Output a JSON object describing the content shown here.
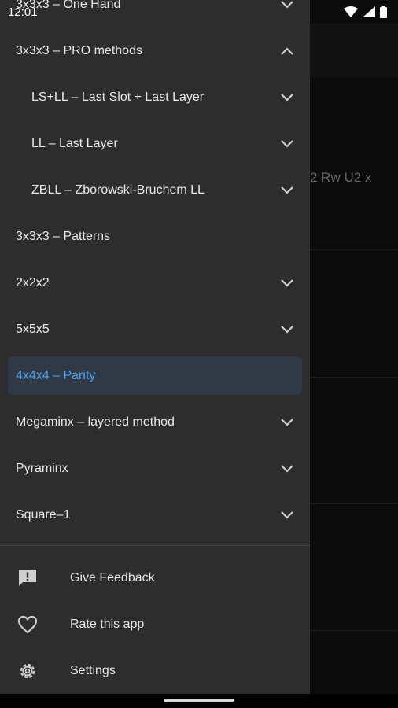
{
  "status_bar": {
    "time": "12:01"
  },
  "background": {
    "partial_text": "2 Rw U2 x"
  },
  "drawer": {
    "items": [
      {
        "label": "3x3x3 – One Hand",
        "level": "top",
        "chevron": "down",
        "selected": false
      },
      {
        "label": "3x3x3 – PRO methods",
        "level": "top",
        "chevron": "up",
        "selected": false
      },
      {
        "label": "LS+LL – Last Slot + Last Layer",
        "level": "sub",
        "chevron": "down",
        "selected": false
      },
      {
        "label": "LL – Last Layer",
        "level": "sub",
        "chevron": "down",
        "selected": false
      },
      {
        "label": "ZBLL – Zborowski-Bruchem LL",
        "level": "sub",
        "chevron": "down",
        "selected": false
      },
      {
        "label": "3x3x3 – Patterns",
        "level": "top",
        "chevron": "none",
        "selected": false
      },
      {
        "label": "2x2x2",
        "level": "top",
        "chevron": "down",
        "selected": false
      },
      {
        "label": "5x5x5",
        "level": "top",
        "chevron": "down",
        "selected": false
      },
      {
        "label": "4x4x4 – Parity",
        "level": "top",
        "chevron": "none",
        "selected": true
      },
      {
        "label": "Megaminx – layered method",
        "level": "top",
        "chevron": "down",
        "selected": false
      },
      {
        "label": "Pyraminx",
        "level": "top",
        "chevron": "down",
        "selected": false
      },
      {
        "label": "Square–1",
        "level": "top",
        "chevron": "down",
        "selected": false
      }
    ],
    "footer": [
      {
        "label": "Give Feedback",
        "icon": "feedback-icon"
      },
      {
        "label": "Rate this app",
        "icon": "heart-icon"
      },
      {
        "label": "Settings",
        "icon": "gear-icon"
      }
    ]
  },
  "colors": {
    "drawer_bg": "#2d2d2d",
    "accent": "#4aa3f0",
    "selected_bg": "#2f3a46"
  }
}
